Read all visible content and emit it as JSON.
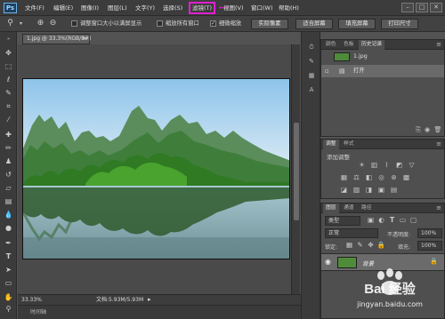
{
  "app": {
    "logo": "Ps"
  },
  "menubar": {
    "items": [
      "文件(F)",
      "编辑(E)",
      "图像(I)",
      "图层(L)",
      "文字(Y)",
      "选择(S)",
      "滤镜(T)",
      "视图(V)",
      "窗口(W)",
      "帮助(H)"
    ],
    "highlighted": "滤镜(T)",
    "highlight_color": "#e21fd2",
    "window_buttons": [
      "–",
      "□",
      "✕"
    ]
  },
  "options": {
    "checkbox_resize": "调整窗口大小以满屏显示",
    "checkbox_zoom_all": "缩放所有窗口",
    "checkbox_scrubby": "细微缩放",
    "btn_actual": "实际像素",
    "btn_fit": "适合屏幕",
    "btn_fill": "填充屏幕",
    "btn_print": "打印尺寸"
  },
  "document": {
    "tab": "1.jpg @ 33.3%(RGB/8#)",
    "close": "×",
    "zoom": "33.33%",
    "status": "文档:5.93M/5.93M"
  },
  "timeline": {
    "label": "时间轴"
  },
  "history_panel": {
    "tabs": [
      "颜色",
      "色板",
      "历史记录"
    ],
    "active_tab": "历史记录",
    "snapshot": "1.jpg",
    "step": "打开"
  },
  "adjust_panel": {
    "tabs": [
      "调整",
      "样式"
    ],
    "title": "添加调整"
  },
  "layers_panel": {
    "tabs": [
      "图层",
      "通道",
      "路径"
    ],
    "kind": "类型",
    "blend_mode": "正常",
    "opacity_label": "不透明度:",
    "opacity": "100%",
    "lock_label": "锁定:",
    "fill_label": "填充:",
    "fill": "100%",
    "layer_name": "背景"
  },
  "watermark": {
    "brand": "Bai 经验",
    "url": "jingyan.baidu.com"
  },
  "colors": {
    "chrome": "#535353",
    "dark": "#3b3b3b",
    "accent": "#e21fd2"
  }
}
